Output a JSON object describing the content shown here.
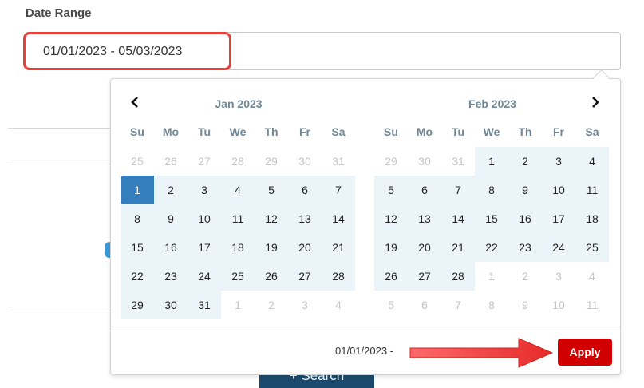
{
  "field": {
    "label": "Date Range",
    "value": "01/01/2023 - 05/03/2023"
  },
  "picker": {
    "prev_icon": "chevron-left-icon",
    "next_icon": "chevron-right-icon",
    "weekdays": [
      "Su",
      "Mo",
      "Tu",
      "We",
      "Th",
      "Fr",
      "Sa"
    ],
    "months": [
      {
        "title": "Jan 2023",
        "weeks": [
          [
            "25",
            "26",
            "27",
            "28",
            "29",
            "30",
            "31"
          ],
          [
            "1",
            "2",
            "3",
            "4",
            "5",
            "6",
            "7"
          ],
          [
            "8",
            "9",
            "10",
            "11",
            "12",
            "13",
            "14"
          ],
          [
            "15",
            "16",
            "17",
            "18",
            "19",
            "20",
            "21"
          ],
          [
            "22",
            "23",
            "24",
            "25",
            "26",
            "27",
            "28"
          ],
          [
            "29",
            "30",
            "31",
            "1",
            "2",
            "3",
            "4"
          ]
        ],
        "off": [
          [
            0,
            0
          ],
          [
            0,
            1
          ],
          [
            0,
            2
          ],
          [
            0,
            3
          ],
          [
            0,
            4
          ],
          [
            0,
            5
          ],
          [
            0,
            6
          ],
          [
            5,
            3
          ],
          [
            5,
            4
          ],
          [
            5,
            5
          ],
          [
            5,
            6
          ]
        ],
        "start": [
          1,
          0
        ]
      },
      {
        "title": "Feb 2023",
        "weeks": [
          [
            "29",
            "30",
            "31",
            "1",
            "2",
            "3",
            "4"
          ],
          [
            "5",
            "6",
            "7",
            "8",
            "9",
            "10",
            "11"
          ],
          [
            "12",
            "13",
            "14",
            "15",
            "16",
            "17",
            "18"
          ],
          [
            "19",
            "20",
            "21",
            "22",
            "23",
            "24",
            "25"
          ],
          [
            "26",
            "27",
            "28",
            "1",
            "2",
            "3",
            "4"
          ],
          [
            "5",
            "6",
            "7",
            "8",
            "9",
            "10",
            "11"
          ]
        ],
        "off": [
          [
            0,
            0
          ],
          [
            0,
            1
          ],
          [
            0,
            2
          ],
          [
            4,
            3
          ],
          [
            4,
            4
          ],
          [
            4,
            5
          ],
          [
            4,
            6
          ],
          [
            5,
            0
          ],
          [
            5,
            1
          ],
          [
            5,
            2
          ],
          [
            5,
            3
          ],
          [
            5,
            4
          ],
          [
            5,
            5
          ],
          [
            5,
            6
          ]
        ],
        "start": null
      }
    ],
    "footer_range": "01/01/2023 -",
    "apply_label": "Apply"
  },
  "background": {
    "search_button_label": "+ Search"
  },
  "colors": {
    "apply": "#d10000",
    "selected": "#357ebd",
    "range": "#ebf4f8",
    "highlight": "#e8413c"
  }
}
